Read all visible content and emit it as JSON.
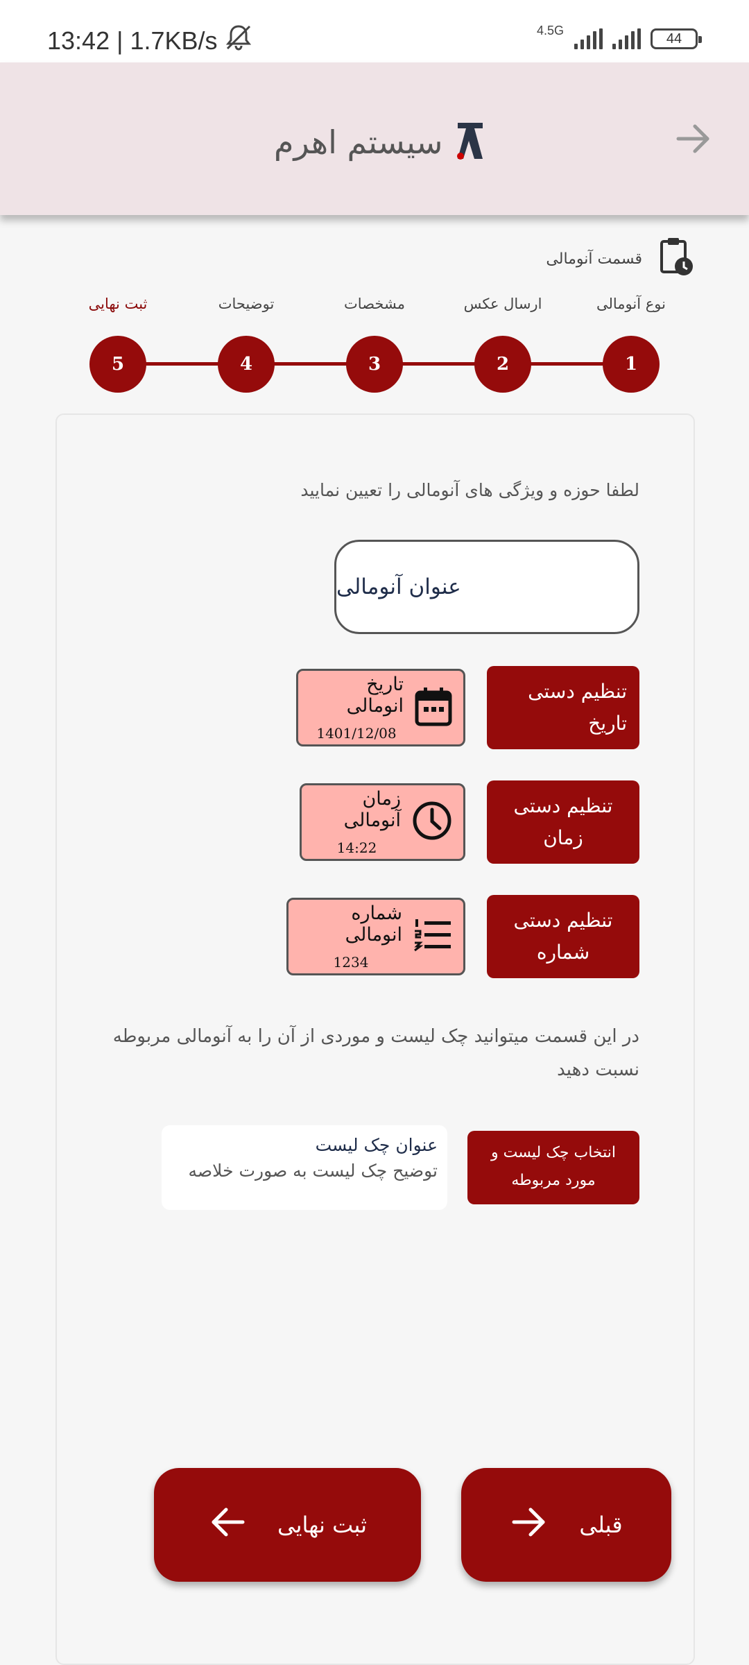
{
  "status_bar": {
    "time_speed": "13:42 | 1.7KB/s",
    "network": "4.5G",
    "battery": "44"
  },
  "header": {
    "app_name": "سیستم اهرم"
  },
  "section": {
    "title": "قسمت آنومالی"
  },
  "stepper": {
    "steps": [
      {
        "number": "1",
        "label": "نوع آنومالی"
      },
      {
        "number": "2",
        "label": "ارسال عکس"
      },
      {
        "number": "3",
        "label": "مشخصات"
      },
      {
        "number": "4",
        "label": "توضیحات"
      },
      {
        "number": "5",
        "label": "ثبت نهایی"
      }
    ],
    "active_label_index": 5
  },
  "form": {
    "prompt": "لطفا حوزه و ویژگی های آنومالی را تعیین نمایید",
    "title_field": "عنوان آنومالی",
    "date": {
      "button": "تنظیم دستی تاریخ",
      "label": "تاریخ انومالی",
      "value": "1401/12/08"
    },
    "time": {
      "button_line1": "تنظیم دستی",
      "button_line2": "زمان",
      "label": "زمان آنومالی",
      "value": "14:22"
    },
    "number": {
      "button_line1": "تنظیم دستی",
      "button_line2": "شماره",
      "label": "شماره انومالی",
      "value": "1234"
    },
    "checklist_description": "در این قسمت میتوانید چک لیست و موردی از آن را به آنومالی مربوطه نسبت دهید",
    "checklist": {
      "title": "عنوان چک لیست",
      "description": "توضیح چک لیست به صورت خلاصه",
      "button_line1": "انتخاب چک لیست و",
      "button_line2": "مورد مربوطه"
    }
  },
  "footer": {
    "submit_label": "ثبت نهایی",
    "previous_label": "قبلی"
  },
  "colors": {
    "primary": "#950b0b",
    "header_bg": "#efe3e6",
    "info_bg": "#ffb3ad",
    "background": "#f6f6f6"
  }
}
